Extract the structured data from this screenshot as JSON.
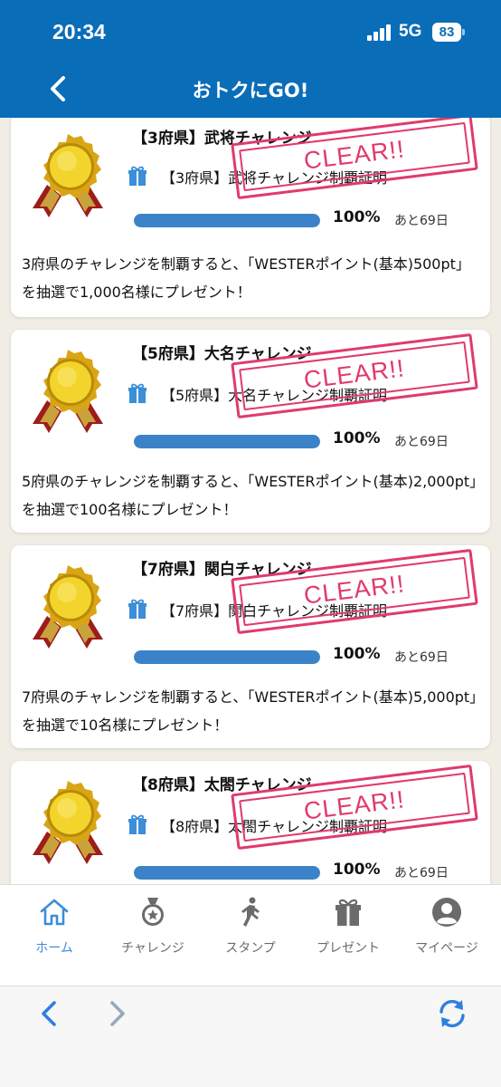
{
  "status": {
    "time": "20:34",
    "network": "5G",
    "battery": "83"
  },
  "header": {
    "title": "おトクにGO!"
  },
  "stamp_text": "CLEAR!!",
  "cards": [
    {
      "title": "【3府県】武将チャレンジ",
      "reward": "【3府県】武将チャレンジ制覇証明",
      "progress": 100,
      "progress_label": "100%",
      "days_left": "あと69日",
      "description": "3府県のチャレンジを制覇すると、「WESTERポイント(基本)500pt」を抽選で1,000名様にプレゼント！"
    },
    {
      "title": "【5府県】大名チャレンジ",
      "reward": "【5府県】大名チャレンジ制覇証明",
      "progress": 100,
      "progress_label": "100%",
      "days_left": "あと69日",
      "description": "5府県のチャレンジを制覇すると、「WESTERポイント(基本)2,000pt」を抽選で100名様にプレゼント！"
    },
    {
      "title": "【7府県】関白チャレンジ",
      "reward": "【7府県】関白チャレンジ制覇証明",
      "progress": 100,
      "progress_label": "100%",
      "days_left": "あと69日",
      "description": "7府県のチャレンジを制覇すると、「WESTERポイント(基本)5,000pt」を抽選で10名様にプレゼント！"
    },
    {
      "title": "【8府県】太閤チャレンジ",
      "reward": "【8府県】太閤チャレンジ制覇証明",
      "progress": 100,
      "progress_label": "100%",
      "days_left": "あと69日"
    }
  ],
  "tabs": [
    {
      "label": "ホーム",
      "icon": "home-icon",
      "active": true
    },
    {
      "label": "チャレンジ",
      "icon": "medal-icon",
      "active": false
    },
    {
      "label": "スタンプ",
      "icon": "walker-icon",
      "active": false
    },
    {
      "label": "プレゼント",
      "icon": "gift-icon",
      "active": false
    },
    {
      "label": "マイページ",
      "icon": "user-icon",
      "active": false
    }
  ],
  "colors": {
    "header_bg": "#0a6db8",
    "stamp": "#e03a6b",
    "progress": "#3b82c8",
    "active_tab": "#3b8ed8"
  }
}
